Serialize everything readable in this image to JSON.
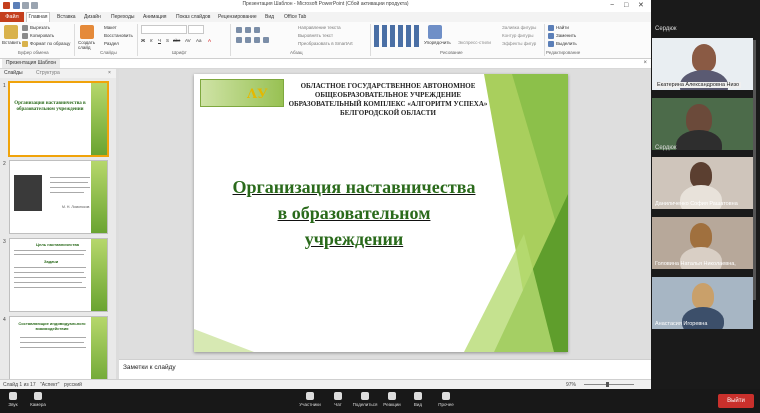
{
  "window": {
    "title": "Презентация Шаблон - Microsoft PowerPoint (Сбой активации продукта)",
    "controls": [
      "−",
      "□",
      "✕"
    ]
  },
  "ribbon": {
    "file_tab": "Файл",
    "tabs": [
      "Главная",
      "Вставка",
      "Дизайн",
      "Переходы",
      "Анимация",
      "Показ слайдов",
      "Рецензирование",
      "Вид",
      "Office Tab"
    ],
    "clipboard": {
      "paste": "Вставить",
      "cut": "Вырезать",
      "copy": "Копировать",
      "format": "Формат по образцу",
      "group": "Буфер обмена"
    },
    "slides": {
      "create": "Создать слайд",
      "layout": "Макет",
      "reset": "Восстановить",
      "section": "Раздел",
      "group": "Слайды"
    },
    "font": {
      "group": "Шрифт",
      "buttons": [
        "Ж",
        "К",
        "Ч",
        "S",
        "abc",
        "AV",
        "Aa",
        "A"
      ]
    },
    "paragraph": {
      "direction": "Направление текста",
      "align": "Выровнять текст",
      "smartart": "Преобразовать в SmartArt",
      "group": "Абзац"
    },
    "drawing": {
      "arrange": "Упорядочить",
      "styles": "Экспресс-стили",
      "fill": "Заливка фигуры",
      "outline": "Контур фигуры",
      "effects": "Эффекты фигур",
      "group": "Рисование"
    },
    "editing": {
      "find": "Найти",
      "replace": "Заменить",
      "select": "Выделить",
      "group": "Редактирование"
    }
  },
  "document_tab": "Презентация Шаблон",
  "panel": {
    "tab_slides": "Слайды",
    "tab_structure": "Структура"
  },
  "thumbnails": [
    {
      "num": "1",
      "title": "Организация наставничества в образовательном учреждении"
    },
    {
      "num": "2",
      "caption": "М. Н. Ломоносов"
    },
    {
      "num": "3",
      "title": "Цель наставничества",
      "sub": "Задачи"
    },
    {
      "num": "4",
      "title": "Составляющие индивидуального взаимодействия"
    }
  ],
  "slide": {
    "org": "ОБЛАСТНОЕ ГОСУДАРСТВЕННОЕ АВТОНОМНОЕ ОБЩЕОБРАЗОВАТЕЛЬНОЕ УЧРЕЖДЕНИЕ ОБРАЗОВАТЕЛЬНЫЙ КОМПЛЕКС «АЛГОРИТМ УСПЕХА» БЕЛГОРОДСКОЙ ОБЛАСТИ",
    "logo_letters": "ΛУ",
    "title_line1": "Организация наставничества",
    "title_line2": "в образовательном",
    "title_line3": "учреждении"
  },
  "notes_placeholder": "Заметки к слайду",
  "status": {
    "slide": "Слайд 1 из 17",
    "theme": "\"Аспект\"",
    "lang": "русский",
    "zoom": "97%"
  },
  "zoom_panel": {
    "header1": "Сердюк",
    "header2": "Сердюк",
    "participants": [
      {
        "name": "Екатерина Александровна Низо"
      },
      {
        "name": ""
      },
      {
        "name": "Даниличенко София Рашатовна"
      },
      {
        "name": "Головина Наталья Николаевна,"
      },
      {
        "name": "Анастасия Игоревна"
      }
    ]
  },
  "zoom_bar": {
    "audio": "Звук",
    "video": "Камера",
    "participants": "Участники",
    "chat": "Чат",
    "share": "Поделиться",
    "reactions": "Реакции",
    "view": "Вид",
    "more": "Прочее",
    "end": "Выйти"
  },
  "colors": {
    "file_tab": "#c43e1c",
    "slide_title": "#2a6a1b",
    "accent_green": "#6aa431",
    "end_button": "#c9302c"
  }
}
